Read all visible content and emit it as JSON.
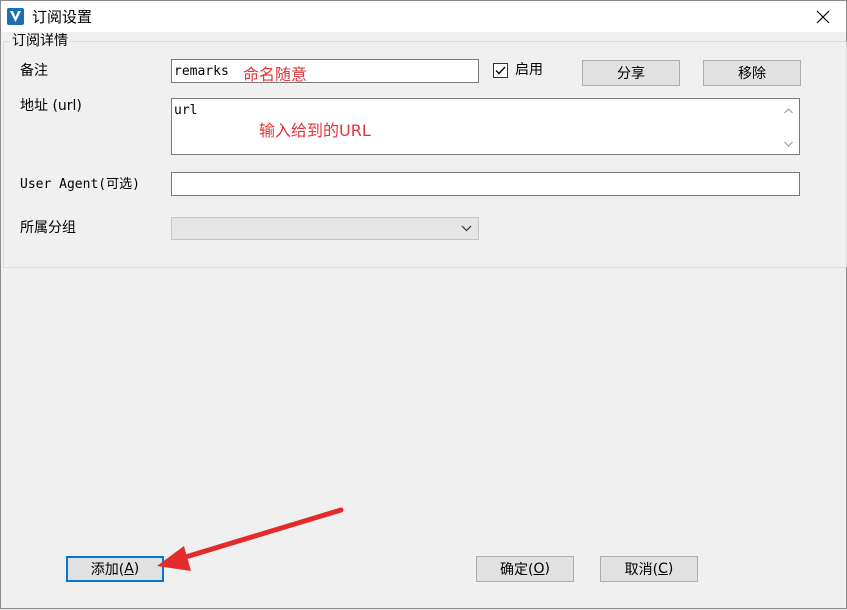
{
  "window": {
    "title": "订阅设置"
  },
  "group": {
    "title": "订阅详情"
  },
  "fields": {
    "remarks_label": "备注",
    "remarks_value": "remarks",
    "url_label": "地址 (url)",
    "url_value": "url",
    "user_agent_label": "User Agent(可选)",
    "user_agent_value": "",
    "group_label": "所属分组",
    "group_value": ""
  },
  "enable": {
    "label": "启用",
    "checked": true
  },
  "buttons": {
    "share": "分享",
    "remove": "移除",
    "add": "添加(",
    "add_key": "A",
    "confirm": "确定(",
    "confirm_key": "O",
    "cancel": "取消(",
    "cancel_key": "C",
    "close_paren": ")"
  },
  "annotations": {
    "remarks_hint": "命名随意",
    "url_hint": "输入给到的URL"
  },
  "colors": {
    "annotation": "#e0353b",
    "default_button_border": "#0078d7",
    "app_icon": "#1a6fb5"
  }
}
